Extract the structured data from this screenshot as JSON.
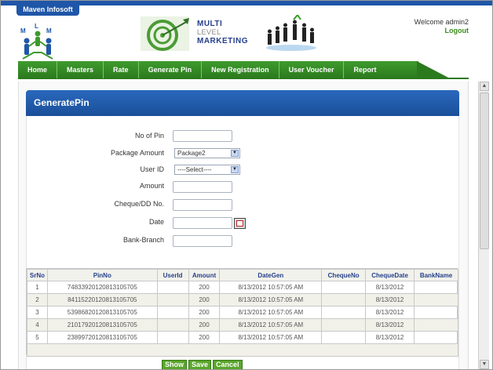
{
  "header": {
    "brand": "Maven Infosoft",
    "logo_letters": [
      "M",
      "L",
      "M"
    ],
    "banner": {
      "line1": "MULTI",
      "line2": "LEVEL",
      "line3": "MARKETING"
    },
    "welcome": "Welcome admin2",
    "logout": "Logout"
  },
  "nav": {
    "items": [
      "Home",
      "Masters",
      "Rate",
      "Generate Pin",
      "New Registration",
      "User Voucher",
      "Report"
    ]
  },
  "form": {
    "title": "GeneratePin",
    "labels": {
      "no_of_pin": "No of Pin",
      "package_amount": "Package Amount",
      "user_id": "User ID",
      "amount": "Amount",
      "cheque_dd": "Cheque/DD No.",
      "date": "Date",
      "bank_branch": "Bank-Branch"
    },
    "values": {
      "no_of_pin": "",
      "package_amount": "Package2",
      "user_id": "----Select----",
      "amount": "",
      "cheque_dd": "",
      "date": "",
      "bank_branch": ""
    }
  },
  "table": {
    "columns": [
      "SrNo",
      "PinNo",
      "UserId",
      "Amount",
      "DateGen",
      "ChequeNo",
      "ChequeDate",
      "BankName"
    ],
    "rows": [
      [
        "1",
        "74833920120813105705",
        "",
        "200",
        "8/13/2012 10:57:05 AM",
        "",
        "8/13/2012",
        ""
      ],
      [
        "2",
        "84115220120813105705",
        "",
        "200",
        "8/13/2012 10:57:05 AM",
        "",
        "8/13/2012",
        ""
      ],
      [
        "3",
        "53986820120813105705",
        "",
        "200",
        "8/13/2012 10:57:05 AM",
        "",
        "8/13/2012",
        ""
      ],
      [
        "4",
        "21017920120813105705",
        "",
        "200",
        "8/13/2012 10:57:05 AM",
        "",
        "8/13/2012",
        ""
      ],
      [
        "5",
        "23899720120813105705",
        "",
        "200",
        "8/13/2012 10:57:05 AM",
        "",
        "8/13/2012",
        ""
      ]
    ]
  },
  "buttons": {
    "show": "Show",
    "save": "Save",
    "cancel": "Cancel"
  },
  "colors": {
    "brand_blue": "#1f56a8",
    "nav_green": "#2c7a1e",
    "button_green": "#5aa62c",
    "header_text": "#27408b"
  }
}
